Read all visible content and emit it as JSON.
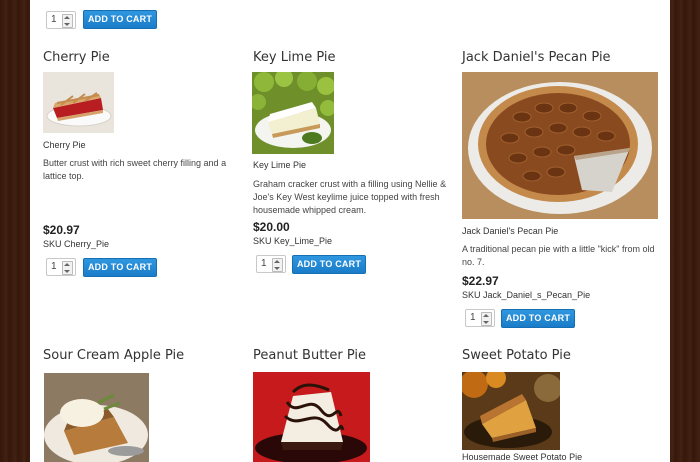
{
  "top_row": {
    "quantity": "1",
    "button_label": "ADD TO CART"
  },
  "products": [
    {
      "title": "Cherry Pie",
      "caption": "Cherry Pie",
      "description": "Butter crust with rich sweet cherry filling and a lattice top.",
      "price": "$20.97",
      "sku": "SKU Cherry_Pie",
      "quantity": "1",
      "button_label": "ADD TO CART"
    },
    {
      "title": "Key Lime Pie",
      "caption": "Key Lime Pie",
      "description": "Graham cracker crust with a filling using Nellie & Joe's Key West keylime juice topped with fresh housemade whipped cream.",
      "price": "$20.00",
      "sku": "SKU Key_Lime_Pie",
      "quantity": "1",
      "button_label": "ADD TO CART"
    },
    {
      "title": "Jack Daniel's Pecan Pie",
      "caption": "Jack Daniel's Pecan Pie",
      "description": "A traditional pecan pie with a little \"kick\" from old no. 7.",
      "price": "$22.97",
      "sku": "SKU Jack_Daniel_s_Pecan_Pie",
      "quantity": "1",
      "button_label": "ADD TO CART"
    },
    {
      "title": "Sour Cream Apple Pie"
    },
    {
      "title": "Peanut Butter Pie"
    },
    {
      "title": "Sweet Potato Pie",
      "caption": "Housemade Sweet Potato Pie"
    }
  ]
}
